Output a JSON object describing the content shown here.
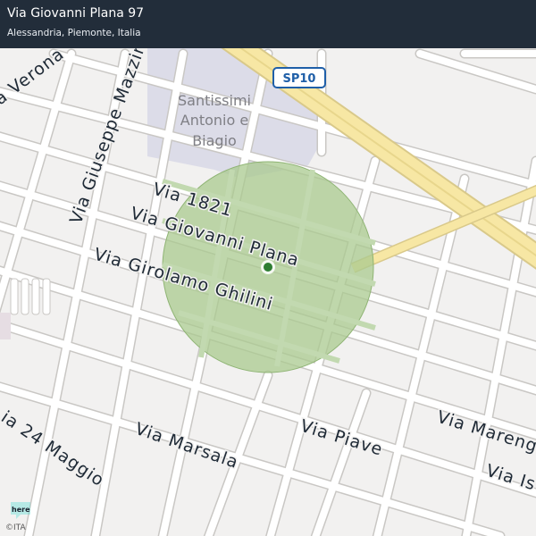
{
  "header": {
    "title": "Via Giovanni Plana 97",
    "subtitle": "Alessandria, Piemonte, Italia"
  },
  "map": {
    "highlight_color": "#a9c98f",
    "marker_color": "#2e7d32",
    "poi_name_lines": [
      "Santissimi",
      "Antonio e",
      "Biagio"
    ],
    "highway_shield": "SP10",
    "streets": {
      "via_verona": "a Verona",
      "via_mazzini": "Via Giuseppe Mazzini",
      "via_1821": "Via 1821",
      "via_plana": "Via Giovanni Plana",
      "via_ghilini": "Via Girolamo Ghilini",
      "via_24_maggio": "ia 24 Maggio",
      "via_marsala": "Via Marsala",
      "via_piave": "Via Piave",
      "via_marengo": "Via Mareng",
      "via_is": "Via Is"
    }
  },
  "attribution": {
    "logo_text": "here",
    "copyright": "©ITA"
  }
}
